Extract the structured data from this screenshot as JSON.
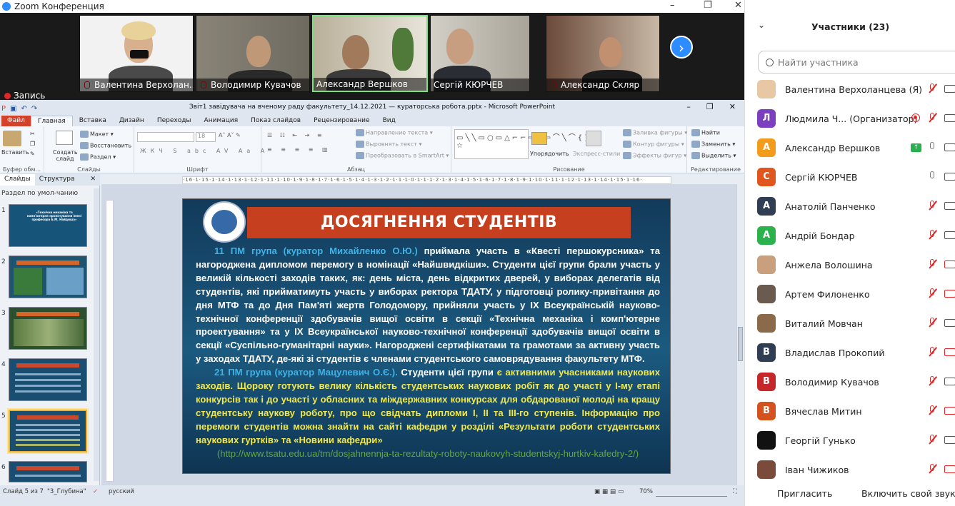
{
  "zoom": {
    "title": "Zoom Конференция",
    "recording": "Запись"
  },
  "gallery": [
    {
      "name": "Валентина Верхолан..."
    },
    {
      "name": "Володимир Кувачов"
    },
    {
      "name": "Александр Вершков"
    },
    {
      "name": "Сергій КЮРЧЕВ"
    },
    {
      "name": "Александр Скляр"
    }
  ],
  "ppt": {
    "title": "Звіт1 завідувача на вченому раду факультету_14.12.2021 — кураторська робота.pptx  -  Microsoft PowerPoint",
    "tabs": [
      "Файл",
      "Главная",
      "Вставка",
      "Дизайн",
      "Переходы",
      "Анимация",
      "Показ слайдов",
      "Рецензирование",
      "Вид"
    ],
    "ribbon": {
      "paste": "Вставить",
      "clipboard": "Буфер обм...",
      "create": "Создать слайд",
      "layout": "Макет",
      "restore": "Восстановить",
      "section": "Раздел",
      "slides": "Слайды",
      "font_size": "18",
      "font": "Шрифт",
      "paragraph": "Абзац",
      "text_dir": "Направление текста",
      "align_text": "Выровнять текст",
      "smartart": "Преобразовать в SmartArt",
      "arrange": "Упорядочить",
      "quick_styles": "Экспресс-стили",
      "fill": "Заливка фигуры",
      "outline": "Контур фигуры",
      "effects": "Эффекты фигур",
      "drawing": "Рисование",
      "find": "Найти",
      "replace": "Заменить",
      "select": "Выделить",
      "editing": "Редактирование"
    },
    "panes": {
      "slides": "Слайды",
      "outline": "Структура",
      "section": "Раздел по умол-чанию"
    },
    "thumb1": "«Технічна механіка та комп'ютерне проектування імені професора Б.М. Найдиша»",
    "status": {
      "slide": "Слайд 5 из 7",
      "theme": "\"3_Глубина\"",
      "lang": "русский",
      "zoom": "70%"
    }
  },
  "slide": {
    "title": "ДОСЯГНЕННЯ СТУДЕНТІВ",
    "p1_a": "11 ПМ група (куратор Михайленко О.Ю.)",
    "p1_b": " приймала участь в «Квесті першокурсника» та нагороджена дипломом перемогу в номінації «Найшвидкіши». Студенти цієї групи брали участь у великій кількості заходів таких, як: день міста, день відкритих дверей, у виборах делегатів від студентів, які прийматимуть участь у виборах ректора ТДАТУ, у підготовці ролику-привітання до дня МТФ та до Дня Пам'яті жертв Голодомору, прийняли участь у ІХ Всеукраїнській науково-технічної конференції здобувачів вищої освіти в секції «Технічна механіка і комп'ютерне проектування» та у ІХ Всеукраїнської науково-технічної конференції здобувачів вищої освіти в секції «Суспільно-гуманітарні науки». Нагороджені сертифікатами та грамотами за активну участь у заходах ТДАТУ, де-які зі студентів є членами студентського самоврядування факультету МТФ.",
    "p2_a": "21 ПМ група (куратор Мацулевич О.Є.).",
    "p2_b": " Студенти цієї групи ",
    "p2_c": "є активними учасниками наукових заходів. Щороку готують велику кількість студентських наукових робіт як до участі у І-му етапі конкурсів так і до участі у обласних та міждержавних конкурсах для обдарованої молоді на кращу студентську наукову роботу, про що свідчать дипломи І, ІІ та ІІІ-го ступенів. Інформацію про перемоги студентів можна знайти на сайті кафедри у розділі «Результати роботи студентських наукових гуртків» та «Новини кафедри»",
    "url": "(http://www.tsatu.edu.ua/tm/dosjahnennja-ta-rezultaty-roboty-naukovyh-studentskyj-hurtkiv-kafedry-2/)"
  },
  "participants": {
    "header": "Участники (23)",
    "search_placeholder": "Найти участника",
    "list": [
      {
        "name": "Валентина Верхоланцева (Я)",
        "avatar": "",
        "color": "#e8c7a4"
      },
      {
        "name": "Людмила Ч... (Организатор)",
        "avatar": "Л",
        "color": "#7b3fbf"
      },
      {
        "name": "Александр Вершков",
        "avatar": "А",
        "color": "#f39c1c"
      },
      {
        "name": "Сергій КЮРЧЕВ",
        "avatar": "С",
        "color": "#e0561e"
      },
      {
        "name": "Анатолій Панченко",
        "avatar": "А",
        "color": "#2f3e52"
      },
      {
        "name": "Андрій Бондар",
        "avatar": "А",
        "color": "#2bb24c"
      },
      {
        "name": "Анжела Волошина",
        "avatar": "",
        "color": "#c9a07e"
      },
      {
        "name": "Артем Филоненко",
        "avatar": "",
        "color": "#6b5a4e"
      },
      {
        "name": "Виталий Мовчан",
        "avatar": "",
        "color": "#8a6a4a"
      },
      {
        "name": "Владислав Прокопий",
        "avatar": "В",
        "color": "#2f3e52"
      },
      {
        "name": "Володимир Кувачов",
        "avatar": "В",
        "color": "#c6282a"
      },
      {
        "name": "Вячеслав Митин",
        "avatar": "В",
        "color": "#d4521e"
      },
      {
        "name": "Георгій Гунько",
        "avatar": "",
        "color": "#111111"
      },
      {
        "name": "Іван Чижиков",
        "avatar": "",
        "color": "#7a4a3a"
      }
    ],
    "invite": "Пригласить",
    "unmute": "Включить свой звук"
  }
}
